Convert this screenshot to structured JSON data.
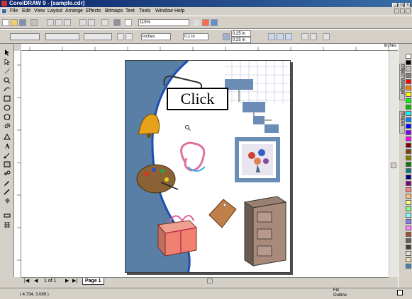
{
  "window": {
    "title": "CorelDRAW 9 - [sample.cdr]",
    "buttons": [
      "_",
      "□",
      "×"
    ]
  },
  "menu": {
    "items": [
      "File",
      "Edit",
      "View",
      "Layout",
      "Arrange",
      "Effects",
      "Bitmaps",
      "Text",
      "Tools",
      "Window",
      "Help"
    ]
  },
  "toolbar": {
    "zoom_value": "115%"
  },
  "property_bar": {
    "units_value": "inches",
    "nudge_value": "0.1 in",
    "dup_x": "0.25 in",
    "dup_y": "0.25 in"
  },
  "ruler": {
    "unit_label": "inches"
  },
  "docker": {
    "tabs": [
      "Object Manager",
      "Shapes"
    ]
  },
  "navigator": {
    "page_count": "1 of 1",
    "page_tab": "Page 1"
  },
  "status": {
    "coordinates": "( 4.734, 3.089 )",
    "fill_label": "Fill",
    "outline_label": "Outline"
  },
  "callout": {
    "text": "Click"
  },
  "palette_colors": [
    "#ffffff",
    "#000000",
    "#c0c0c0",
    "#808080",
    "#ff0000",
    "#ff8000",
    "#ffff00",
    "#00ff00",
    "#00c000",
    "#00ffff",
    "#0080ff",
    "#0000ff",
    "#8000ff",
    "#ff00ff",
    "#800000",
    "#804000",
    "#808000",
    "#008000",
    "#008080",
    "#000080",
    "#800080",
    "#ff8080",
    "#ffc080",
    "#ffff80",
    "#80ff80",
    "#80ffff",
    "#8080ff",
    "#ff80ff",
    "#a0522d",
    "#606060",
    "#404040",
    "#e0e0e0",
    "#f5deb3",
    "#4682b4"
  ]
}
